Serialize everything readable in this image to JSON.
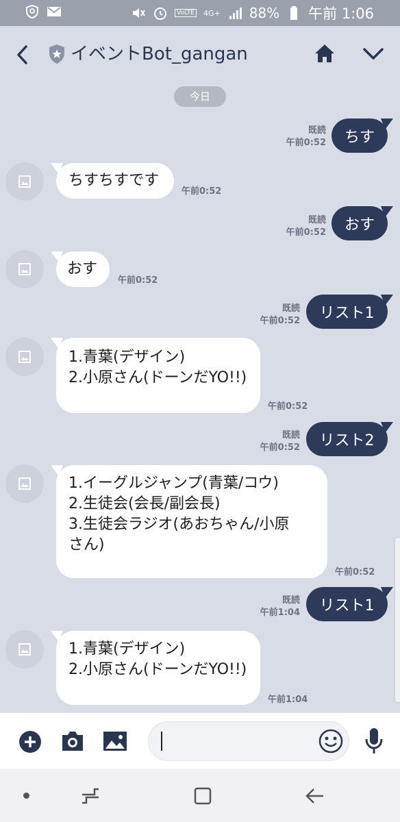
{
  "status_bar": {
    "battery_text": "88%",
    "time_text": "午前 1:06",
    "network_text": "4G+",
    "volte_text": "VoLTE"
  },
  "header": {
    "title": "イベントBot_gangan"
  },
  "chat": {
    "date_label": "今日",
    "messages": [
      {
        "side": "out",
        "text": "ちす",
        "read": "既読",
        "time": "午前0:52"
      },
      {
        "side": "in",
        "text": "ちすちすです",
        "time": "午前0:52"
      },
      {
        "side": "out",
        "text": "おす",
        "read": "既読",
        "time": "午前0:52"
      },
      {
        "side": "in",
        "text": "おす",
        "time": "午前0:52"
      },
      {
        "side": "out",
        "text": "リスト1",
        "read": "既読",
        "time": "午前0:52"
      },
      {
        "side": "in",
        "text": "1.青葉(デザイン)\n2.小原さん(ドーンだYO!!)",
        "time": "午前0:52"
      },
      {
        "side": "out",
        "text": "リスト2",
        "read": "既読",
        "time": "午前0:52"
      },
      {
        "side": "in",
        "text": "1.イーグルジャンプ(青葉/コウ)\n2.生徒会(会長/副会長)\n3.生徒会ラジオ(あおちゃん/小原\nさん)",
        "time": "午前0:52"
      },
      {
        "side": "out",
        "text": "リスト1",
        "read": "既読",
        "time": "午前1:04"
      },
      {
        "side": "in",
        "text": "1.青葉(デザイン)\n2.小原さん(ドーンだYO!!)",
        "time": "午前1:04"
      }
    ]
  },
  "input": {
    "placeholder": ""
  },
  "colors": {
    "background": "#d7dce6",
    "outgoing_bubble": "#2d3a5a",
    "incoming_bubble": "#ffffff",
    "header_text": "#2a3550"
  },
  "icons": [
    "back-arrow-icon",
    "shield-star-icon",
    "home-icon",
    "chevron-down-icon",
    "plus-icon",
    "camera-icon",
    "image-icon",
    "emoji-icon",
    "microphone-icon"
  ]
}
